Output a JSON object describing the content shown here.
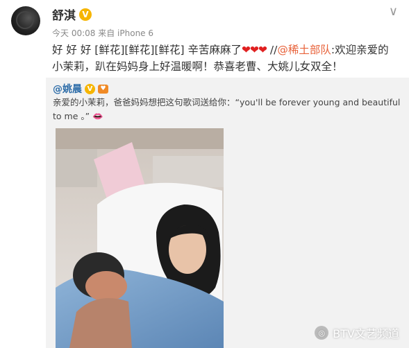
{
  "post": {
    "username": "舒淇",
    "verified_badge": "V",
    "timestamp": "今天 00:08",
    "source": "来自 iPhone 6",
    "text_prefix": "好 好 好 [鲜花][鲜花][鲜花] 辛苦麻麻了",
    "hearts": "❤❤❤",
    "separator": " //",
    "mention": "@稀土部队",
    "text_suffix": ":欢迎亲爱的小茉莉，趴在妈妈身上好温暖啊！恭喜老曹、大姚儿女双全！"
  },
  "repost": {
    "username": "@姚晨",
    "verified_badge": "V",
    "stamp": "♥",
    "text": "亲爱的小茉莉，爸爸妈妈想把这句歌词送给你：“you'll be forever young and beautiful to me 。”",
    "lips": "👄"
  },
  "watermark": {
    "label": "BTV文艺频道"
  },
  "icons": {
    "menu": "chevron-down-icon"
  }
}
